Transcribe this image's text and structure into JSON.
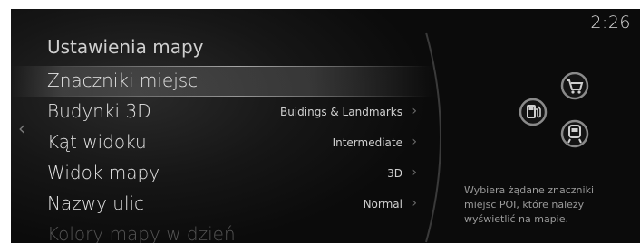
{
  "status": {
    "clock": "2:26"
  },
  "page": {
    "title": "Ustawienia mapy"
  },
  "menu": {
    "items": [
      {
        "label": "Znaczniki miejsc",
        "value": "",
        "selected": true
      },
      {
        "label": "Budynki 3D",
        "value": "Buidings & Landmarks"
      },
      {
        "label": "Kąt widoku",
        "value": "Intermediate"
      },
      {
        "label": "Widok mapy",
        "value": "3D"
      },
      {
        "label": "Nazwy ulic",
        "value": "Normal"
      },
      {
        "label": "Kolory mapy w dzień",
        "value": ""
      }
    ]
  },
  "icons": [
    "shopping-cart-icon",
    "gas-station-icon",
    "train-icon"
  ],
  "description": {
    "text": "Wybiera żądane znaczniki miejsc POI, które należy wyświetlić na mapie."
  }
}
